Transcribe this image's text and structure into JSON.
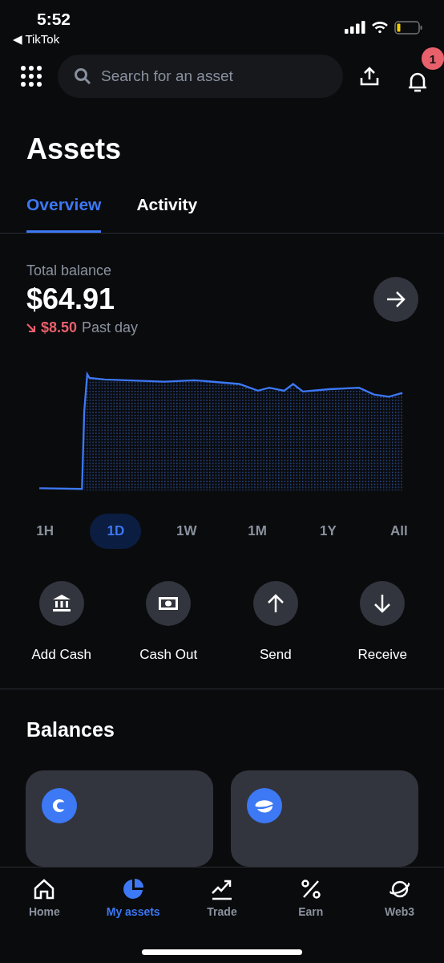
{
  "status_bar": {
    "time": "5:52",
    "back_label": "◀ TikTok"
  },
  "search": {
    "placeholder": "Search for an asset"
  },
  "notifications": {
    "badge": "1"
  },
  "title": "Assets",
  "tabs": [
    {
      "label": "Overview",
      "selected": true
    },
    {
      "label": "Activity",
      "selected": false
    }
  ],
  "balance": {
    "label": "Total balance",
    "amount": "$64.91",
    "change": "$8.50",
    "change_period": "Past day"
  },
  "ranges": [
    {
      "label": "1H",
      "selected": false
    },
    {
      "label": "1D",
      "selected": true
    },
    {
      "label": "1W",
      "selected": false
    },
    {
      "label": "1M",
      "selected": false
    },
    {
      "label": "1Y",
      "selected": false
    },
    {
      "label": "All",
      "selected": false
    }
  ],
  "actions": [
    {
      "kind": "bank",
      "label": "Add Cash"
    },
    {
      "kind": "cash",
      "label": "Cash Out"
    },
    {
      "kind": "send",
      "label": "Send"
    },
    {
      "kind": "receive",
      "label": "Receive"
    }
  ],
  "balances": {
    "title": "Balances",
    "cards": [
      {
        "kind": "coin"
      },
      {
        "kind": "planet"
      }
    ]
  },
  "nav": [
    {
      "kind": "home",
      "label": "Home",
      "selected": false
    },
    {
      "kind": "assets",
      "label": "My assets",
      "selected": true
    },
    {
      "kind": "trade",
      "label": "Trade",
      "selected": false
    },
    {
      "kind": "earn",
      "label": "Earn",
      "selected": false
    },
    {
      "kind": "web3",
      "label": "Web3",
      "selected": false
    }
  ]
}
